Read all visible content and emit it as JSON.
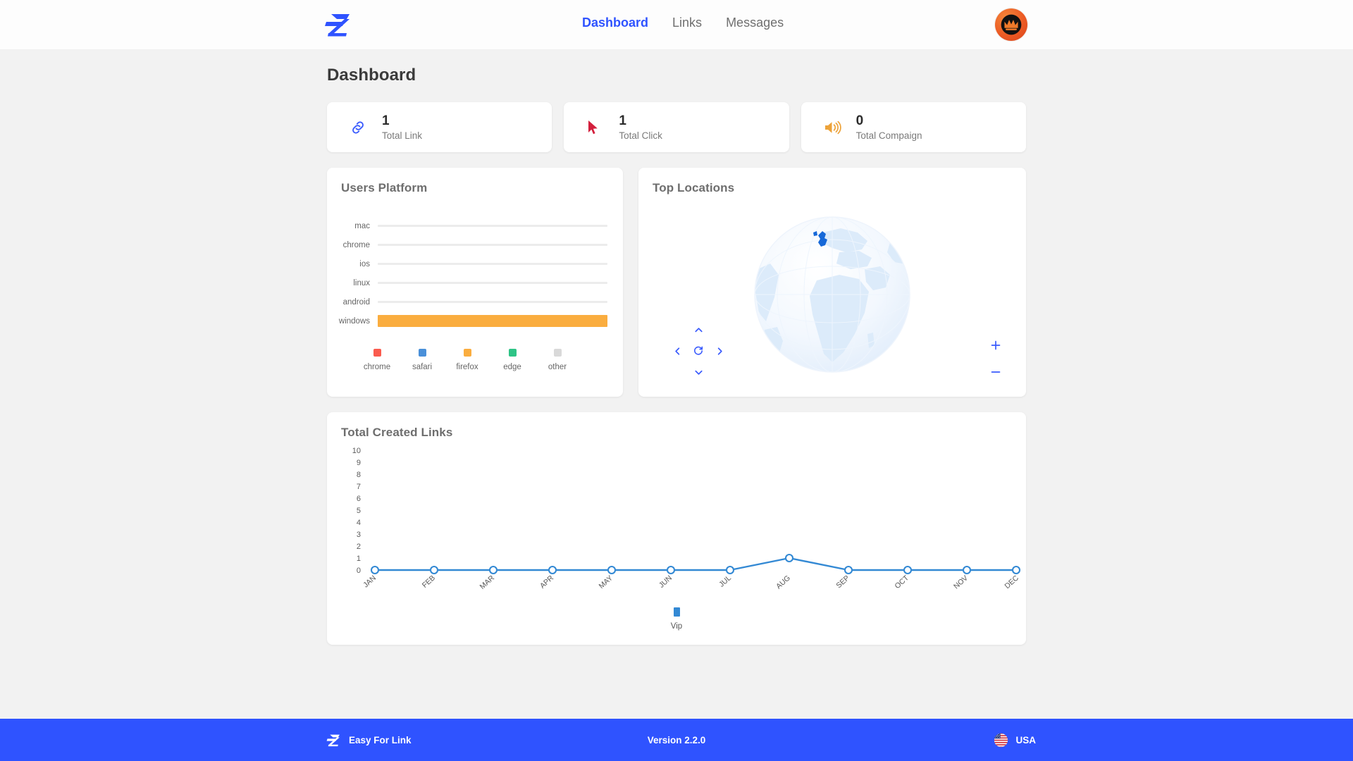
{
  "header": {
    "logo_icon": "ez-logo-icon",
    "nav": [
      {
        "label": "Dashboard",
        "active": true
      },
      {
        "label": "Links",
        "active": false
      },
      {
        "label": "Messages",
        "active": false
      }
    ],
    "avatar_icon": "crown-avatar-icon"
  },
  "main": {
    "page_title": "Dashboard",
    "stats": [
      {
        "value": "1",
        "label": "Total Link",
        "icon": "link-icon",
        "color": "#3a5bfd"
      },
      {
        "value": "1",
        "label": "Total Click",
        "icon": "cursor-click-icon",
        "color": "#d31f3c"
      },
      {
        "value": "0",
        "label": "Total Compaign",
        "icon": "megaphone-speaker-icon",
        "color": "#eda33a"
      }
    ],
    "platform": {
      "title": "Users Platform"
    },
    "locations": {
      "title": "Top Locations",
      "controls": {
        "up": "arrow-up-icon",
        "down": "arrow-down-icon",
        "left": "arrow-left-icon",
        "right": "arrow-right-icon",
        "reset": "reset-rotate-icon",
        "zoom_in": "plus-icon",
        "zoom_out": "minus-icon"
      },
      "highlighted_country": "United Kingdom"
    },
    "links_chart": {
      "title": "Total Created Links"
    }
  },
  "footer": {
    "logo_icon": "ez-logo-icon",
    "brand": "Easy For Link",
    "version": "Version 2.2.0",
    "country": "USA",
    "flag_icon": "usa-flag-icon",
    "background": "#2f53ff"
  },
  "chart_data": [
    {
      "type": "bar",
      "orientation": "horizontal",
      "title": "Users Platform",
      "categories": [
        "mac",
        "chrome",
        "ios",
        "linux",
        "android",
        "windows"
      ],
      "values": [
        0,
        0,
        0,
        0,
        0,
        1
      ],
      "max": 1,
      "bar_color": "#faad3f",
      "track_color": "#ececec",
      "grid": false,
      "xlabel": "",
      "ylabel": "",
      "legend_position": "bottom",
      "legend": [
        {
          "label": "chrome",
          "color": "#fa5b4e"
        },
        {
          "label": "safari",
          "color": "#4a90d9"
        },
        {
          "label": "firefox",
          "color": "#faad3f"
        },
        {
          "label": "edge",
          "color": "#2ec486"
        },
        {
          "label": "other",
          "color": "#d9d9d9"
        }
      ]
    },
    {
      "type": "line",
      "title": "Total Created Links",
      "categories": [
        "JAN",
        "FEB",
        "MAR",
        "APR",
        "MAY",
        "JUN",
        "JUL",
        "AUG",
        "SEP",
        "OCT",
        "NOV",
        "DEC"
      ],
      "yticks": [
        "10",
        "9",
        "8",
        "7",
        "6",
        "5",
        "4",
        "3",
        "2",
        "1",
        "0"
      ],
      "ylim": [
        0,
        10
      ],
      "grid": false,
      "xlabel": "",
      "ylabel": "",
      "legend_position": "bottom",
      "series": [
        {
          "name": "Vip",
          "color": "#3389d4",
          "values": [
            0,
            0,
            0,
            0,
            0,
            0,
            0,
            1,
            0,
            0,
            0,
            0
          ]
        }
      ]
    }
  ]
}
